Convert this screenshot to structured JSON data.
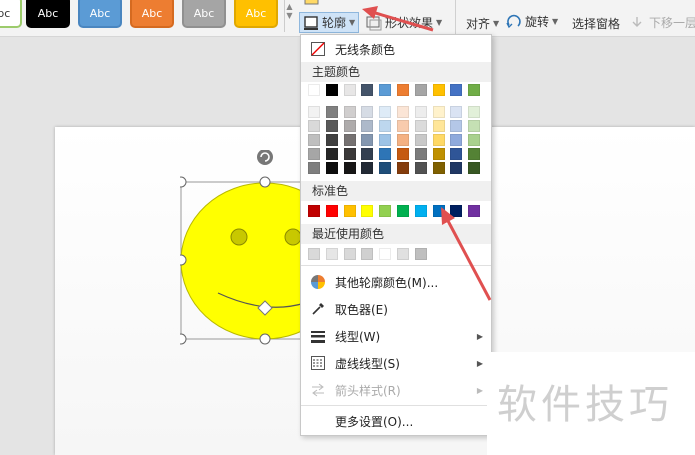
{
  "ribbon": {
    "styles": [
      {
        "label": "Abc",
        "bg": "#ffffff",
        "fg": "#333333",
        "border": "#9ccb6b"
      },
      {
        "label": "Abc",
        "bg": "#000000",
        "fg": "#ffffff",
        "border": "#000000"
      },
      {
        "label": "Abc",
        "bg": "#5b9bd5",
        "fg": "#ffffff",
        "border": "#4a86c0"
      },
      {
        "label": "Abc",
        "bg": "#ed7d31",
        "fg": "#ffffff",
        "border": "#d56a20"
      },
      {
        "label": "Abc",
        "bg": "#a5a5a5",
        "fg": "#ffffff",
        "border": "#909090"
      },
      {
        "label": "Abc",
        "bg": "#ffc000",
        "fg": "#ffffff",
        "border": "#e0a800"
      }
    ],
    "outline_label": "轮廓",
    "shape_effect_label": "形状效果",
    "align_label": "对齐",
    "rotate_label": "旋转",
    "select_pane_label": "选择窗格",
    "move_down_label": "下移一层"
  },
  "menu": {
    "no_line": "无线条颜色",
    "theme_colors_title": "主题颜色",
    "theme_top_row": [
      "#ffffff",
      "#000000",
      "#e7e6e6",
      "#44546a",
      "#5b9bd5",
      "#ed7d31",
      "#a5a5a5",
      "#ffc000",
      "#4472c4",
      "#70ad47"
    ],
    "theme_shades": [
      [
        "#f2f2f2",
        "#808080",
        "#d0cece",
        "#d6dce5",
        "#deebf7",
        "#fbe5d6",
        "#ededed",
        "#fff2cc",
        "#dae3f3",
        "#e2f0d9"
      ],
      [
        "#d9d9d9",
        "#595959",
        "#aeabab",
        "#adb9ca",
        "#bdd7ee",
        "#f8cbad",
        "#dbdbdb",
        "#ffe699",
        "#b4c7e7",
        "#c5e0b4"
      ],
      [
        "#bfbfbf",
        "#404040",
        "#757171",
        "#8497b0",
        "#9dc3e6",
        "#f4b183",
        "#c9c9c9",
        "#ffd966",
        "#8faadc",
        "#a9d18e"
      ],
      [
        "#a6a6a6",
        "#262626",
        "#3a3838",
        "#333f50",
        "#2e75b6",
        "#c55a11",
        "#7b7b7b",
        "#bf9000",
        "#2f5597",
        "#548235"
      ],
      [
        "#7f7f7f",
        "#0d0d0d",
        "#171616",
        "#222a35",
        "#1f4e79",
        "#843c0c",
        "#525252",
        "#7f6000",
        "#203864",
        "#385723"
      ]
    ],
    "standard_title": "标准色",
    "standard_colors": [
      "#c00000",
      "#ff0000",
      "#ffc000",
      "#ffff00",
      "#92d050",
      "#00b050",
      "#00b0f0",
      "#0070c0",
      "#002060",
      "#7030a0"
    ],
    "recent_title": "最近使用颜色",
    "recent_colors": [
      "#d9d9d9",
      "#e6e6e6",
      "#d9d9d9",
      "#d0d0d0",
      "#ffffff",
      "#e0e0e0",
      "#bfbfbf"
    ],
    "more_colors": "其他轮廓颜色(M)...",
    "eyedropper": "取色器(E)",
    "line_type": "线型(W)",
    "dash_type": "虚线线型(S)",
    "arrow_style": "箭头样式(R)",
    "more_settings": "更多设置(O)..."
  },
  "watermark": "软件技巧"
}
